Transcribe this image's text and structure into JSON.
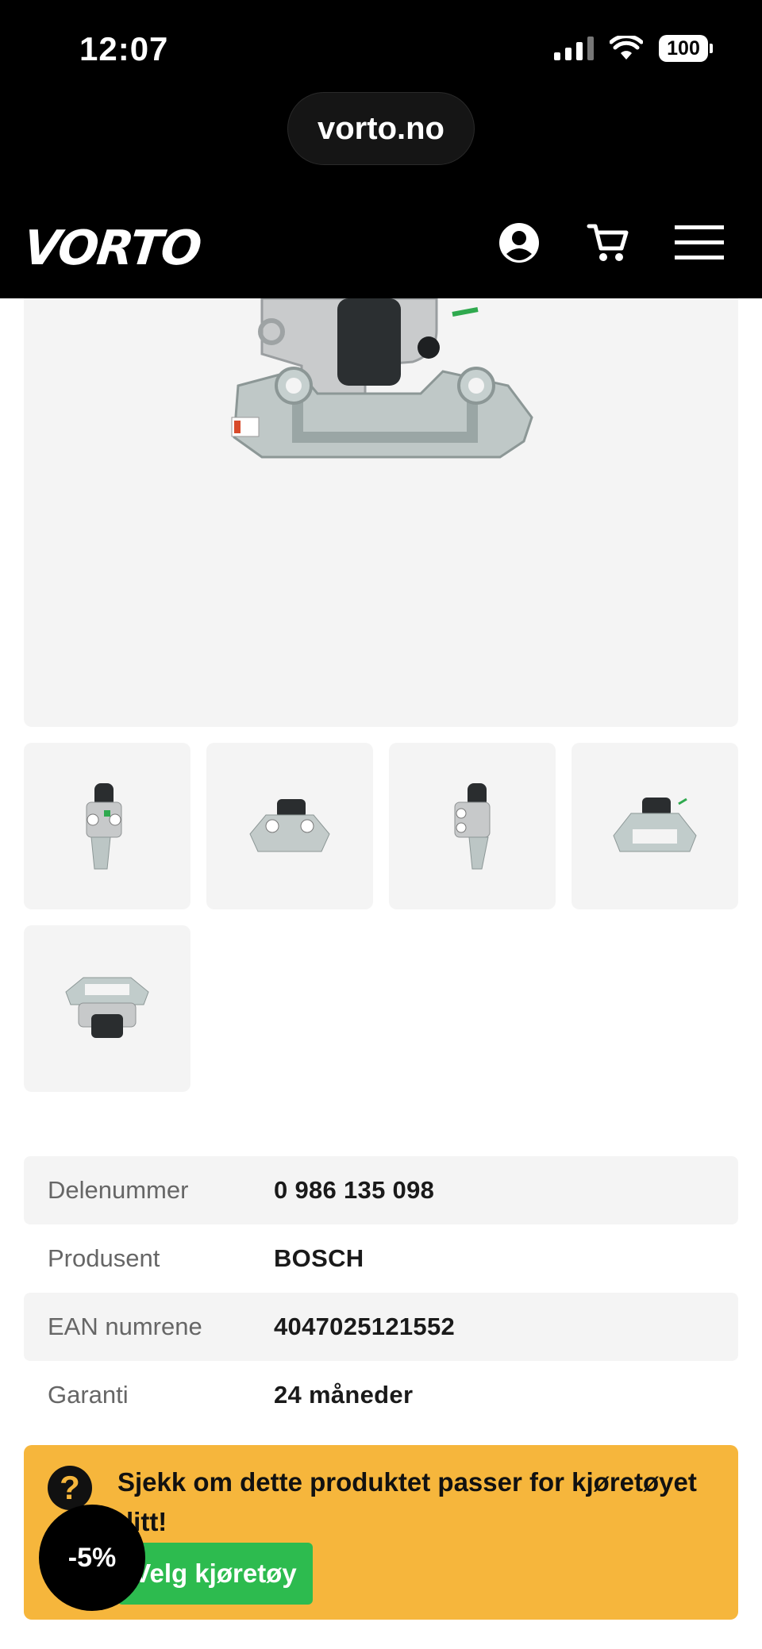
{
  "status_bar": {
    "time": "12:07",
    "battery": "100"
  },
  "browser": {
    "url": "vorto.no"
  },
  "header": {
    "logo": "VORTO",
    "icons": [
      "account-icon",
      "cart-icon",
      "menu-icon"
    ]
  },
  "gallery": {
    "thumbnail_count": 5
  },
  "specs": [
    {
      "label": "Delenummer",
      "value": "0 986 135 098"
    },
    {
      "label": "Produsent",
      "value": "BOSCH"
    },
    {
      "label": "EAN numrene",
      "value": "4047025121552"
    },
    {
      "label": "Garanti",
      "value": "24 måneder"
    }
  ],
  "fitment": {
    "text": "Sjekk om dette produktet passer for kjøretøyet ditt!",
    "button": "Velg kjøretøy"
  },
  "discount_badge": "-5%",
  "colors": {
    "header_bg": "#000000",
    "banner": "#f6b63c",
    "button": "#2dbb4f",
    "panel": "#f4f4f4"
  }
}
